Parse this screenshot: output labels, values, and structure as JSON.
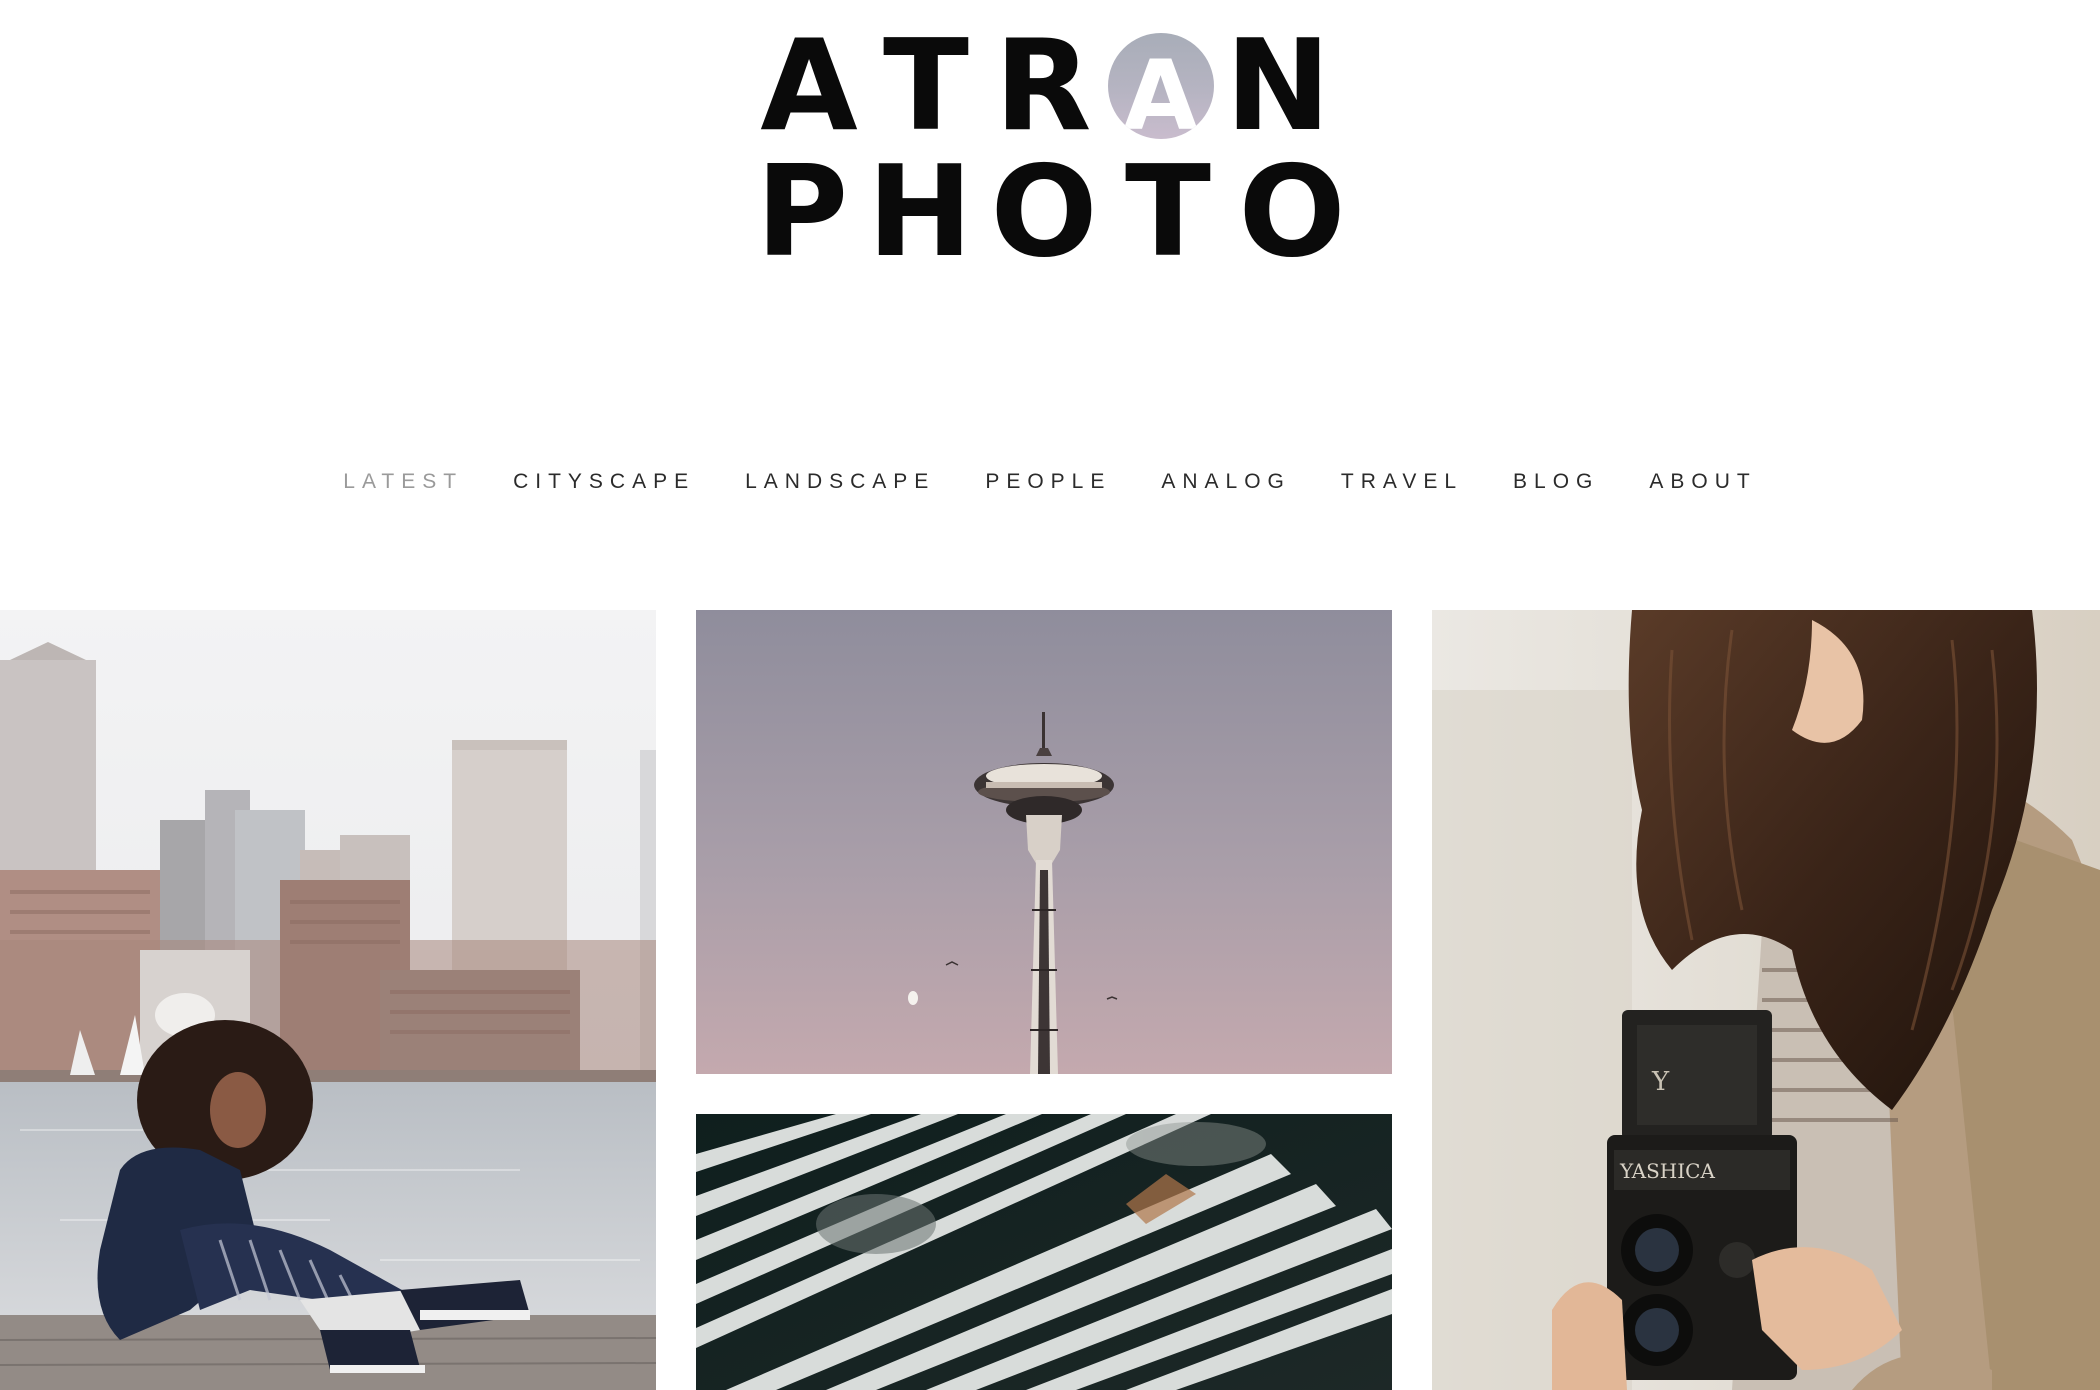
{
  "logo": {
    "line1": [
      "A",
      "T",
      "R",
      "A",
      "N"
    ],
    "line2": [
      "P",
      "H",
      "O",
      "T",
      "O"
    ],
    "circle_fill": "#b4b3c1"
  },
  "nav": {
    "items": [
      {
        "label": "LATEST",
        "active": true
      },
      {
        "label": "CITYSCAPE",
        "active": false
      },
      {
        "label": "LANDSCAPE",
        "active": false
      },
      {
        "label": "PEOPLE",
        "active": false
      },
      {
        "label": "ANALOG",
        "active": false
      },
      {
        "label": "TRAVEL",
        "active": false
      },
      {
        "label": "BLOG",
        "active": false
      },
      {
        "label": "ABOUT",
        "active": false
      }
    ],
    "active_color": "#9a9a9a",
    "text_color": "#2b2b2b"
  },
  "gallery": {
    "photos": [
      {
        "subject": "woman sitting on pier with city skyline"
      },
      {
        "subject": "space needle tower at dusk"
      },
      {
        "subject": "abstract striped shadows"
      },
      {
        "subject": "woman holding twin lens camera"
      }
    ],
    "camera_brand": "YASHICA"
  }
}
